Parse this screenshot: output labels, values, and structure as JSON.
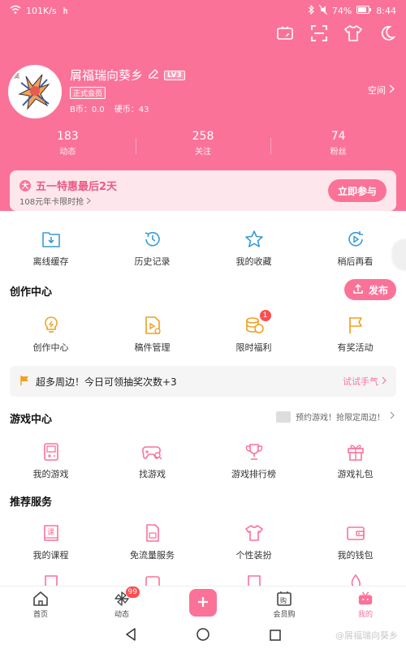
{
  "statusbar": {
    "network": "101K/s",
    "battery": "74%",
    "time": "8:44"
  },
  "profile": {
    "name": "屑福瑞向葵乡",
    "level": "LV3",
    "member_badge": "正式会员",
    "bcoin": "B币：0.0",
    "coin": "硬币：43",
    "space_link": "空间"
  },
  "stats": [
    {
      "value": "183",
      "label": "动态"
    },
    {
      "value": "258",
      "label": "关注"
    },
    {
      "value": "74",
      "label": "粉丝"
    }
  ],
  "promo": {
    "icon_char": "大",
    "title": "五一特惠最后2天",
    "subtitle": "108元年卡限时抢",
    "button": "立即参与"
  },
  "quick_actions": [
    {
      "label": "离线缓存",
      "icon": "download-icon"
    },
    {
      "label": "历史记录",
      "icon": "history-icon"
    },
    {
      "label": "我的收藏",
      "icon": "star-icon"
    },
    {
      "label": "稍后再看",
      "icon": "watch-later-icon"
    }
  ],
  "creation": {
    "title": "创作中心",
    "publish": "发布",
    "items": [
      {
        "label": "创作中心",
        "icon": "bulb-icon"
      },
      {
        "label": "稿件管理",
        "icon": "manuscript-icon"
      },
      {
        "label": "限时福利",
        "icon": "coins-icon",
        "badge": "1"
      },
      {
        "label": "有奖活动",
        "icon": "flag-icon"
      }
    ]
  },
  "notice": {
    "text": "超多周边！今日可领抽奖次数+3",
    "cta": "试试手气"
  },
  "game": {
    "title": "游戏中心",
    "promo": "预约游戏！抢限定周边！",
    "items": [
      {
        "label": "我的游戏",
        "icon": "gamepad-icon"
      },
      {
        "label": "找游戏",
        "icon": "game-search-icon"
      },
      {
        "label": "游戏排行榜",
        "icon": "trophy-icon"
      },
      {
        "label": "游戏礼包",
        "icon": "gift-icon"
      }
    ]
  },
  "services": {
    "title": "推荐服务",
    "items": [
      {
        "label": "我的课程",
        "icon": "course-icon"
      },
      {
        "label": "免流量服务",
        "icon": "sim-icon"
      },
      {
        "label": "个性装扮",
        "icon": "shirt-icon"
      },
      {
        "label": "我的钱包",
        "icon": "wallet-icon"
      }
    ]
  },
  "tabbar": {
    "items": [
      {
        "label": "首页",
        "icon": "home-icon"
      },
      {
        "label": "动态",
        "icon": "pinwheel-icon",
        "badge": "99"
      },
      {
        "label": "",
        "icon": "plus-icon"
      },
      {
        "label": "会员购",
        "icon": "shop-icon"
      },
      {
        "label": "我的",
        "icon": "tv-icon"
      }
    ]
  },
  "watermark": "@屑福瑞向葵乡",
  "colors": {
    "accent": "#fb7299"
  }
}
